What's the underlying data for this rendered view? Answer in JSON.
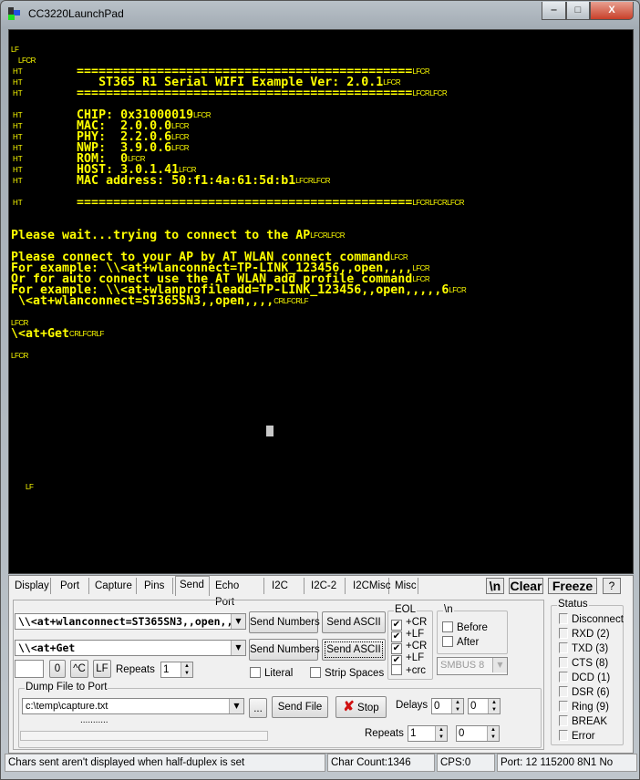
{
  "window": {
    "title": "CC3220LaunchPad",
    "minimize": "‒",
    "maximize": "□",
    "close": "X"
  },
  "terminal": {
    "text_color": "#ffff00",
    "background": "#000000",
    "lines": [
      {
        "row": 0,
        "ht": false,
        "text": "",
        "ctrl": "LF"
      },
      {
        "row": 1,
        "ht": false,
        "text": " ",
        "ctrl": "LFCR"
      },
      {
        "row": 2,
        "ht": true,
        "text": "         ==============================================",
        "ctrl": "LFCR"
      },
      {
        "row": 3,
        "ht": true,
        "text": "            ST365 R1 Serial WIFI Example Ver: 2.0.1",
        "ctrl": "LFCR"
      },
      {
        "row": 4,
        "ht": true,
        "text": "         ==============================================",
        "ctrl": "LFCRLFCR"
      },
      {
        "row": 6,
        "ht": true,
        "text": "         CHIP: 0x31000019",
        "ctrl": "LFCR"
      },
      {
        "row": 7,
        "ht": true,
        "text": "         MAC:  2.0.0.0",
        "ctrl": "LFCR"
      },
      {
        "row": 8,
        "ht": true,
        "text": "         PHY:  2.2.0.6",
        "ctrl": "LFCR"
      },
      {
        "row": 9,
        "ht": true,
        "text": "         NWP:  3.9.0.6",
        "ctrl": "LFCR"
      },
      {
        "row": 10,
        "ht": true,
        "text": "         ROM:  0",
        "ctrl": "LFCR"
      },
      {
        "row": 11,
        "ht": true,
        "text": "         HOST: 3.0.1.41",
        "ctrl": "LFCR"
      },
      {
        "row": 12,
        "ht": true,
        "text": "         MAC address: 50:f1:4a:61:5d:b1",
        "ctrl": "LFCRLFCR"
      },
      {
        "row": 14,
        "ht": true,
        "text": "         ==============================================",
        "ctrl": "LFCRLFCRLFCR"
      },
      {
        "row": 17,
        "ht": false,
        "text": "Please wait...trying to connect to the AP",
        "ctrl": "LFCRLFCR"
      },
      {
        "row": 19,
        "ht": false,
        "text": "Please connect to your AP by AT WLAN connect command",
        "ctrl": "LFCR"
      },
      {
        "row": 20,
        "ht": false,
        "text": "For example: \\\\<at+wlanconnect=TP-LINK_123456,,open,,,,",
        "ctrl": "LFCR"
      },
      {
        "row": 21,
        "ht": false,
        "text": "Or for auto connect use the AT WLAN add profile command",
        "ctrl": "LFCR"
      },
      {
        "row": 22,
        "ht": false,
        "text": "For example: \\\\<at+wlanprofileadd=TP-LINK_123456,,open,,,,,6",
        "ctrl": "LFCR"
      },
      {
        "row": 23,
        "ht": false,
        "text": " \\<at+wlanconnect=ST365SN3,,open,,,,",
        "ctrl": "CRLFCRLF"
      },
      {
        "row": 25,
        "ht": false,
        "text": "",
        "ctrl": "LFCR"
      },
      {
        "row": 26,
        "ht": false,
        "text": "\\<at+Get",
        "ctrl": "CRLFCRLF"
      },
      {
        "row": 28,
        "ht": false,
        "text": "",
        "ctrl": "LFCR"
      },
      {
        "row": 40,
        "ht": false,
        "text": "  ",
        "ctrl": "LF"
      }
    ],
    "ht_mark": "HT"
  },
  "tabs": [
    "Display",
    "Port",
    "Capture",
    "Pins",
    "Send",
    "Echo Port",
    "I2C",
    "I2C-2",
    "I2CMisc",
    "Misc"
  ],
  "active_tab": "Send",
  "toolbar": {
    "newline": "\\n",
    "clear": "Clear",
    "freeze": "Freeze",
    "help": "?"
  },
  "send": {
    "input1": "\\\\<at+wlanconnect=ST365SN3,,open,,,,",
    "input2": "\\\\<at+Get",
    "send_numbers": "Send Numbers",
    "send_ascii": "Send ASCII",
    "small_input": "",
    "btn_zero": "0",
    "btn_ctrl_c": "^C",
    "btn_lf": "LF",
    "repeats_label": "Repeats",
    "repeats_value": "1",
    "literal": "Literal",
    "strip_spaces": "Strip Spaces",
    "eol": {
      "label": "EOL",
      "items": [
        {
          "label": "+CR",
          "checked": true
        },
        {
          "label": "+LF",
          "checked": true
        },
        {
          "label": "+CR",
          "checked": true
        },
        {
          "label": "+LF",
          "checked": true
        },
        {
          "label": "+crc",
          "checked": false
        }
      ]
    },
    "newline_group": {
      "label": "\\n",
      "before": "Before",
      "after": "After"
    },
    "smbus": "SMBUS 8"
  },
  "dump": {
    "label": "Dump File to Port",
    "file": "c:\\temp\\capture.txt",
    "browse": "...",
    "send_file": "Send File",
    "stop": "Stop",
    "delays_label": "Delays",
    "delay1": "0",
    "delay2": "0",
    "progress_text": "...........",
    "repeats_label": "Repeats",
    "repeats1": "1",
    "repeats2": "0",
    "progress": 0
  },
  "status_group": {
    "label": "Status",
    "items": [
      "Disconnect",
      "RXD (2)",
      "TXD (3)",
      "CTS (8)",
      "DCD (1)",
      "DSR (6)",
      "Ring (9)",
      "BREAK",
      "Error"
    ]
  },
  "statusbar": {
    "message": "Chars sent aren't displayed when half-duplex is set",
    "char_count": "Char Count:1346",
    "cps": "CPS:0",
    "port": "Port: 12 115200 8N1 No"
  }
}
